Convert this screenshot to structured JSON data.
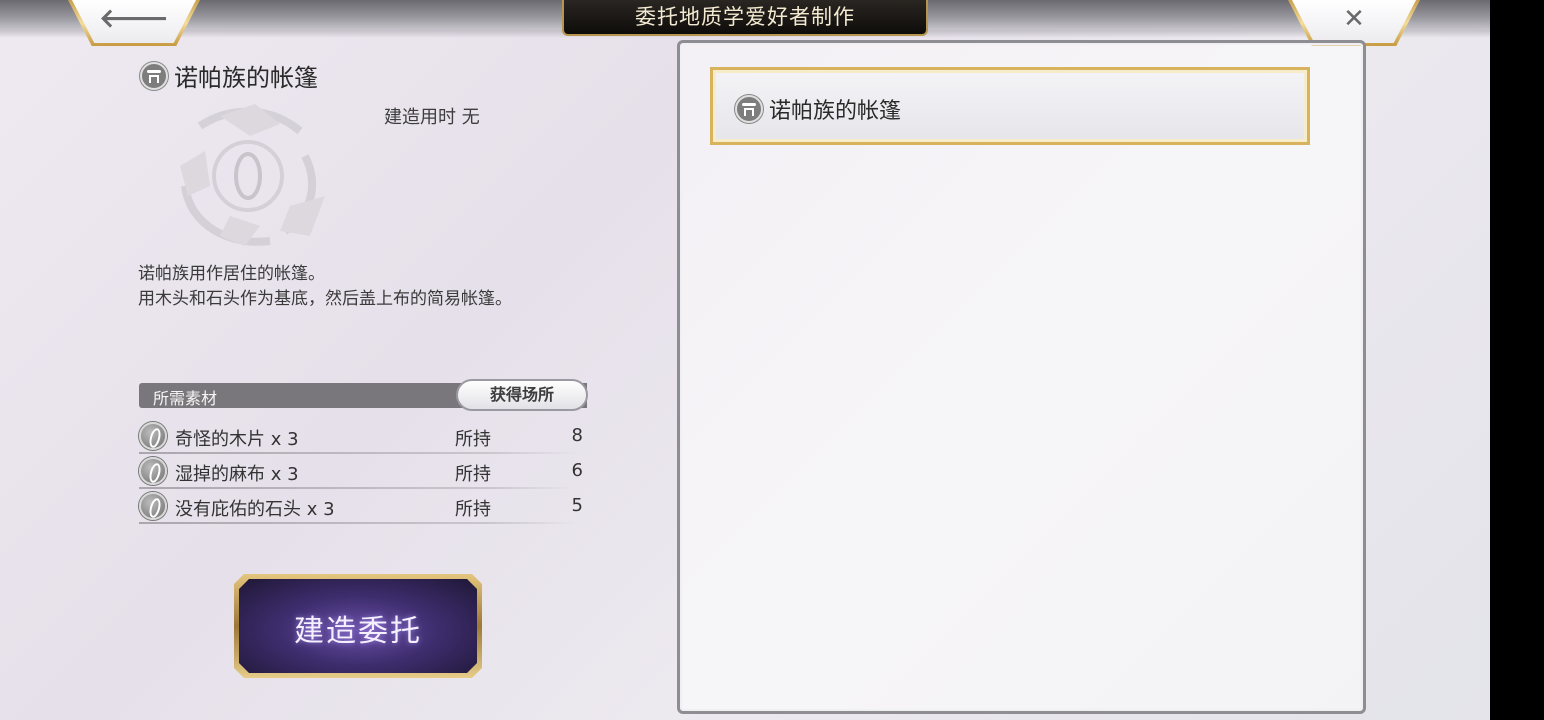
{
  "header": {
    "title": "委托地质学爱好者制作",
    "back_glyph": "🡐",
    "close_glyph": "✕"
  },
  "detail": {
    "item_name": "诺帕族的帐篷",
    "build_time": "建造用时 无",
    "description_line1": "诺帕族用作居住的帐篷。",
    "description_line2": "用木头和石头作为基底，然后盖上布的简易帐篷。"
  },
  "materials": {
    "header_label": "所需素材",
    "source_button_label": "获得场所",
    "rows": [
      {
        "name": "奇怪的木片 x 3",
        "held_label": "所持",
        "count": "8"
      },
      {
        "name": "湿掉的麻布 x 3",
        "held_label": "所持",
        "count": "6"
      },
      {
        "name": "没有庇佑的石头 x 3",
        "held_label": "所持",
        "count": "5"
      }
    ]
  },
  "action": {
    "commission_label": "建造委托"
  },
  "list": {
    "items": [
      {
        "label": "诺帕族的帐篷",
        "selected": true
      }
    ]
  },
  "colors": {
    "accent_gold": "#d8b35e",
    "button_purple": "#3f2e70"
  }
}
